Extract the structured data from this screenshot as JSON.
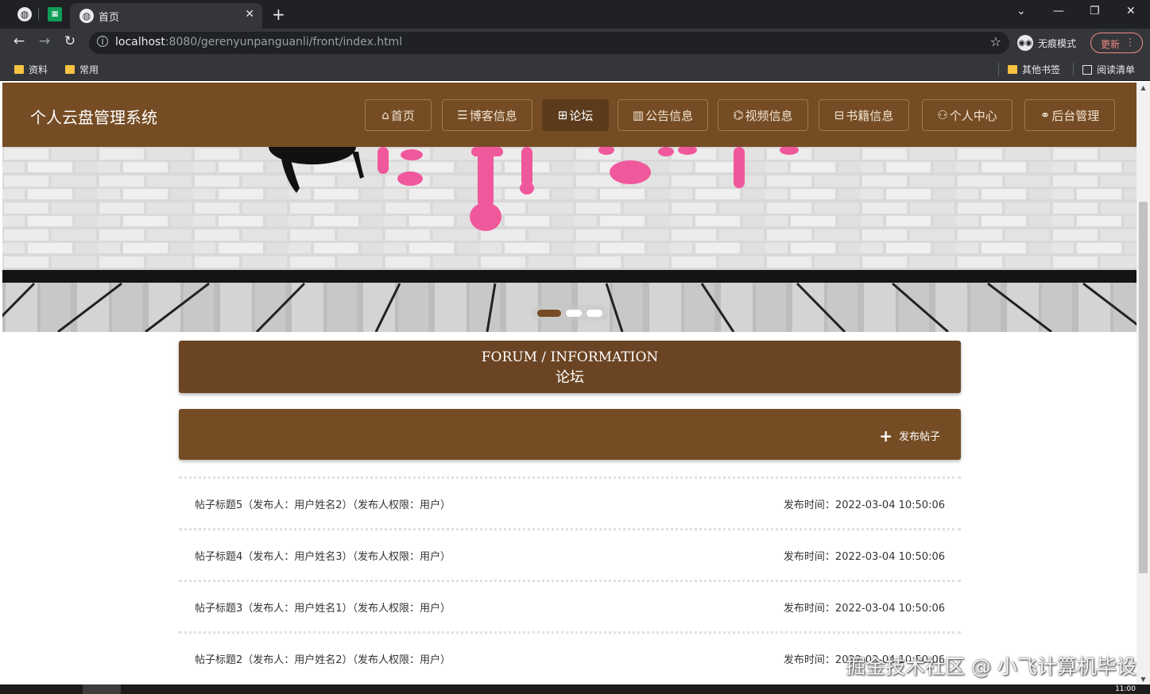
{
  "browser": {
    "tab_title": "首页",
    "url_host": "localhost",
    "url_path": ":8080/gerenyunpanguanli/front/index.html",
    "incognito_label": "无痕模式",
    "update_label": "更新",
    "bookmarks": [
      "资料",
      "常用"
    ],
    "other_bookmarks": "其他书签",
    "reading_list": "阅读清单"
  },
  "site": {
    "logo": "个人云盘管理系统",
    "nav": [
      {
        "icon": "⌂",
        "label": "首页"
      },
      {
        "icon": "☰",
        "label": "博客信息"
      },
      {
        "icon": "⊞",
        "label": "论坛"
      },
      {
        "icon": "▥",
        "label": "公告信息"
      },
      {
        "icon": "⌬",
        "label": "视频信息"
      },
      {
        "icon": "⊟",
        "label": "书籍信息"
      },
      {
        "icon": "⚇",
        "label": "个人中心"
      },
      {
        "icon": "⚭",
        "label": "后台管理"
      }
    ],
    "active_nav": "论坛"
  },
  "section": {
    "title_en": "FORUM / INFORMATION",
    "title_cn": "论坛"
  },
  "toolbar": {
    "publish_label": "发布帖子"
  },
  "posts": [
    {
      "title": "帖子标题5（发布人：用户姓名2）（发布人权限：用户）",
      "time": "发布时间：2022-03-04 10:50:06"
    },
    {
      "title": "帖子标题4（发布人：用户姓名3）（发布人权限：用户）",
      "time": "发布时间：2022-03-04 10:50:06"
    },
    {
      "title": "帖子标题3（发布人：用户姓名1）（发布人权限：用户）",
      "time": "发布时间：2022-03-04 10:50:06"
    },
    {
      "title": "帖子标题2（发布人：用户姓名2）（发布人权限：用户）",
      "time": "发布时间：2022-03-04 10:50:06"
    }
  ],
  "watermark": "掘金技术社区 @ 小飞计算机毕设",
  "clock": "11:00",
  "colors": {
    "brand": "#754c24",
    "brand_dark": "#6b4423",
    "paint_pink": "#f0589c"
  }
}
